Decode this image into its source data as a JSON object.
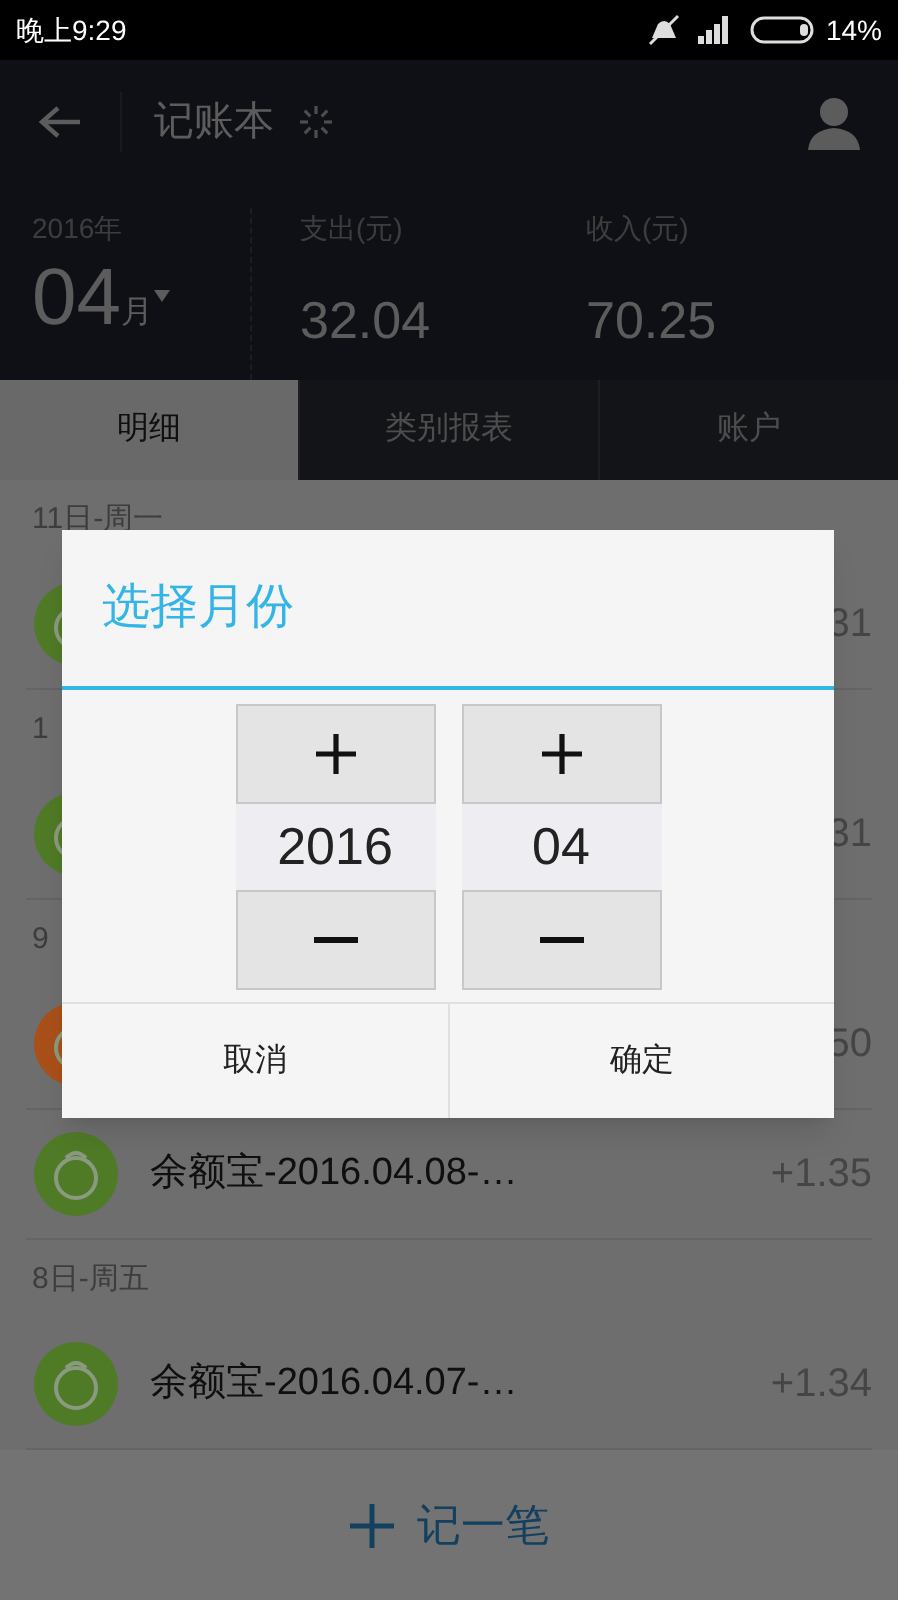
{
  "status_bar": {
    "time": "晚上9:29",
    "battery": "14%"
  },
  "title_bar": {
    "title": "记账本"
  },
  "summary": {
    "year": "2016年",
    "month": "04",
    "month_unit": "月",
    "expense_label": "支出(元)",
    "expense": "32.04",
    "income_label": "收入(元)",
    "income": "70.25"
  },
  "tabs": [
    {
      "label": "明细",
      "selected": true
    },
    {
      "label": "类别报表",
      "selected": false
    },
    {
      "label": "账户",
      "selected": false
    }
  ],
  "sections": [
    {
      "date": "11日-周一",
      "entries": [
        {
          "color": "#4f7a26",
          "amount": "31"
        }
      ]
    },
    {
      "date": "1",
      "entries": [
        {
          "color": "#4f7a26",
          "amount": "31"
        }
      ]
    },
    {
      "date": "9",
      "entries": [
        {
          "color": "#a9501a",
          "amount": "50"
        },
        {
          "color": "#4f7a26",
          "title": "余额宝-2016.04.08-…",
          "amount": "+1.35"
        }
      ]
    },
    {
      "date": "8日-周五",
      "entries": [
        {
          "color": "#4f7a26",
          "title": "余额宝-2016.04.07-…",
          "amount": "+1.34"
        }
      ]
    }
  ],
  "add_button": {
    "label": "记一笔"
  },
  "dialog": {
    "title": "选择月份",
    "pickers": [
      {
        "value": "2016"
      },
      {
        "value": "04"
      }
    ],
    "buttons": [
      "取消",
      "确定"
    ]
  }
}
